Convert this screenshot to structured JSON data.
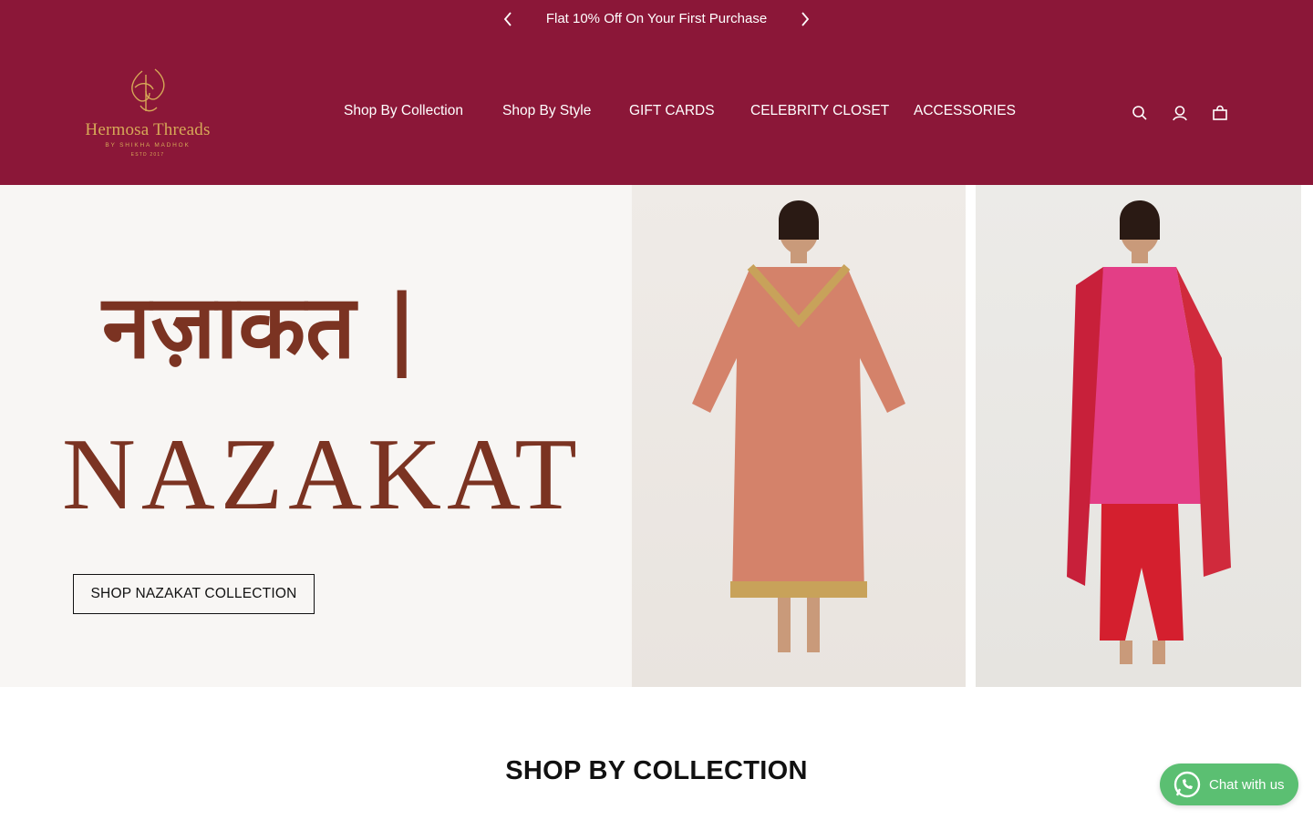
{
  "announcement": {
    "text": "Flat 10% Off On Your First Purchase",
    "prev_icon": "chevron-left-icon",
    "next_icon": "chevron-right-icon"
  },
  "brand": {
    "name": "Hermosa Threads",
    "tagline": "BY SHIKHA MADHOK",
    "estd": "ESTD 2017",
    "color": "#d6a857"
  },
  "nav": {
    "items": [
      "Shop By Collection",
      "Shop By Style",
      "GIFT CARDS",
      "CELEBRITY CLOSET",
      "ACCESSORIES"
    ]
  },
  "header_icons": [
    "search-icon",
    "user-icon",
    "bag-icon"
  ],
  "hero": {
    "hindi_title": "नज़ाकत |",
    "english_title": "NAZAKAT",
    "cta_label": "SHOP NAZAKAT COLLECTION",
    "title_color": "#7b3322"
  },
  "section": {
    "title": "SHOP BY COLLECTION"
  },
  "chat": {
    "label": "Chat with us",
    "icon": "whatsapp-icon",
    "color": "#5bbf72"
  },
  "colors": {
    "primary": "#8b1738",
    "hero_bg": "#f8f6f4"
  }
}
